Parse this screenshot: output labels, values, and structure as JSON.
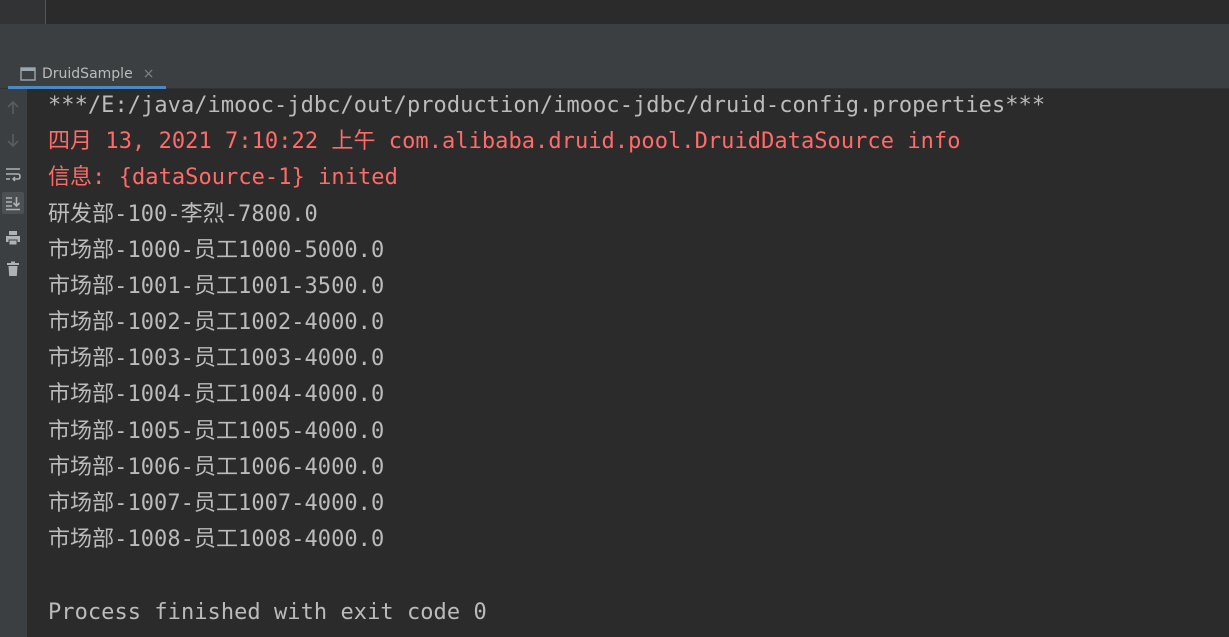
{
  "tool_window": {
    "tab_label": "DruidSample",
    "tab_close": "×"
  },
  "toolbar": {
    "icons": [
      "up-arrow-icon",
      "down-arrow-icon",
      "soft-wrap-icon",
      "scroll-to-end-icon",
      "print-icon",
      "trash-icon"
    ]
  },
  "console": {
    "lines": [
      "***/E:/java/imooc-jdbc/out/production/imooc-jdbc/druid-config.properties***",
      "四月 13, 2021 7:10:22 上午 com.alibaba.druid.pool.DruidDataSource info",
      "信息: {dataSource-1} inited",
      "研发部-100-李烈-7800.0",
      "市场部-1000-员工1000-5000.0",
      "市场部-1001-员工1001-3500.0",
      "市场部-1002-员工1002-4000.0",
      "市场部-1003-员工1003-4000.0",
      "市场部-1004-员工1004-4000.0",
      "市场部-1005-员工1005-4000.0",
      "市场部-1006-员工1006-4000.0",
      "市场部-1007-员工1007-4000.0",
      "市场部-1008-员工1008-4000.0",
      "",
      "Process finished with exit code 0"
    ]
  },
  "colors": {
    "background": "#2b2b2b",
    "panel": "#3c3f41",
    "stdout_text": "#bbbbbb",
    "stderr_text": "#ff6b68",
    "tab_underline": "#4a88c7"
  }
}
